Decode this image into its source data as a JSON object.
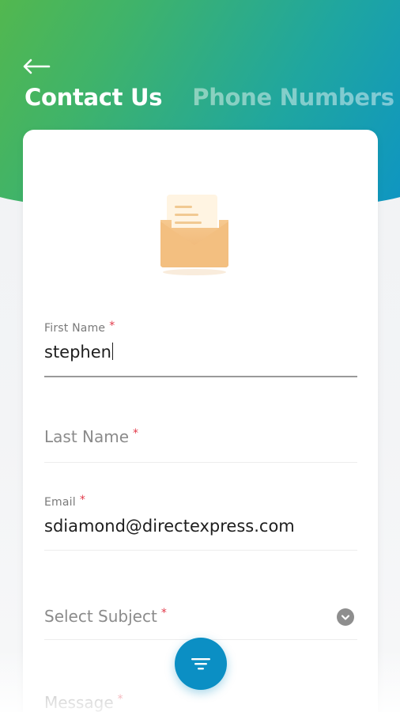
{
  "header": {
    "back_icon": "arrow-left-icon",
    "tabs": [
      {
        "label": "Contact Us",
        "active": true
      },
      {
        "label": "Phone Numbers",
        "active": false
      }
    ]
  },
  "colors": {
    "gradient_start": "#58b947",
    "gradient_end": "#0b92c9",
    "fab": "#0b8fc4",
    "required": "#e23a4a",
    "envelope": "#f0b877"
  },
  "form": {
    "illustration_icon": "open-envelope-icon",
    "first_name": {
      "label": "First Name",
      "required_mark": "*",
      "value": "stephen"
    },
    "last_name": {
      "label": "Last Name",
      "required_mark": "*",
      "value": ""
    },
    "email": {
      "label": "Email",
      "required_mark": "*",
      "value": "sdiamond@directexpress.com"
    },
    "subject": {
      "placeholder": "Select Subject",
      "required_mark": "*",
      "icon": "chevron-down-icon"
    },
    "message": {
      "label": "Message",
      "required_mark": "*"
    }
  },
  "fab": {
    "icon": "filter-lines-icon"
  }
}
